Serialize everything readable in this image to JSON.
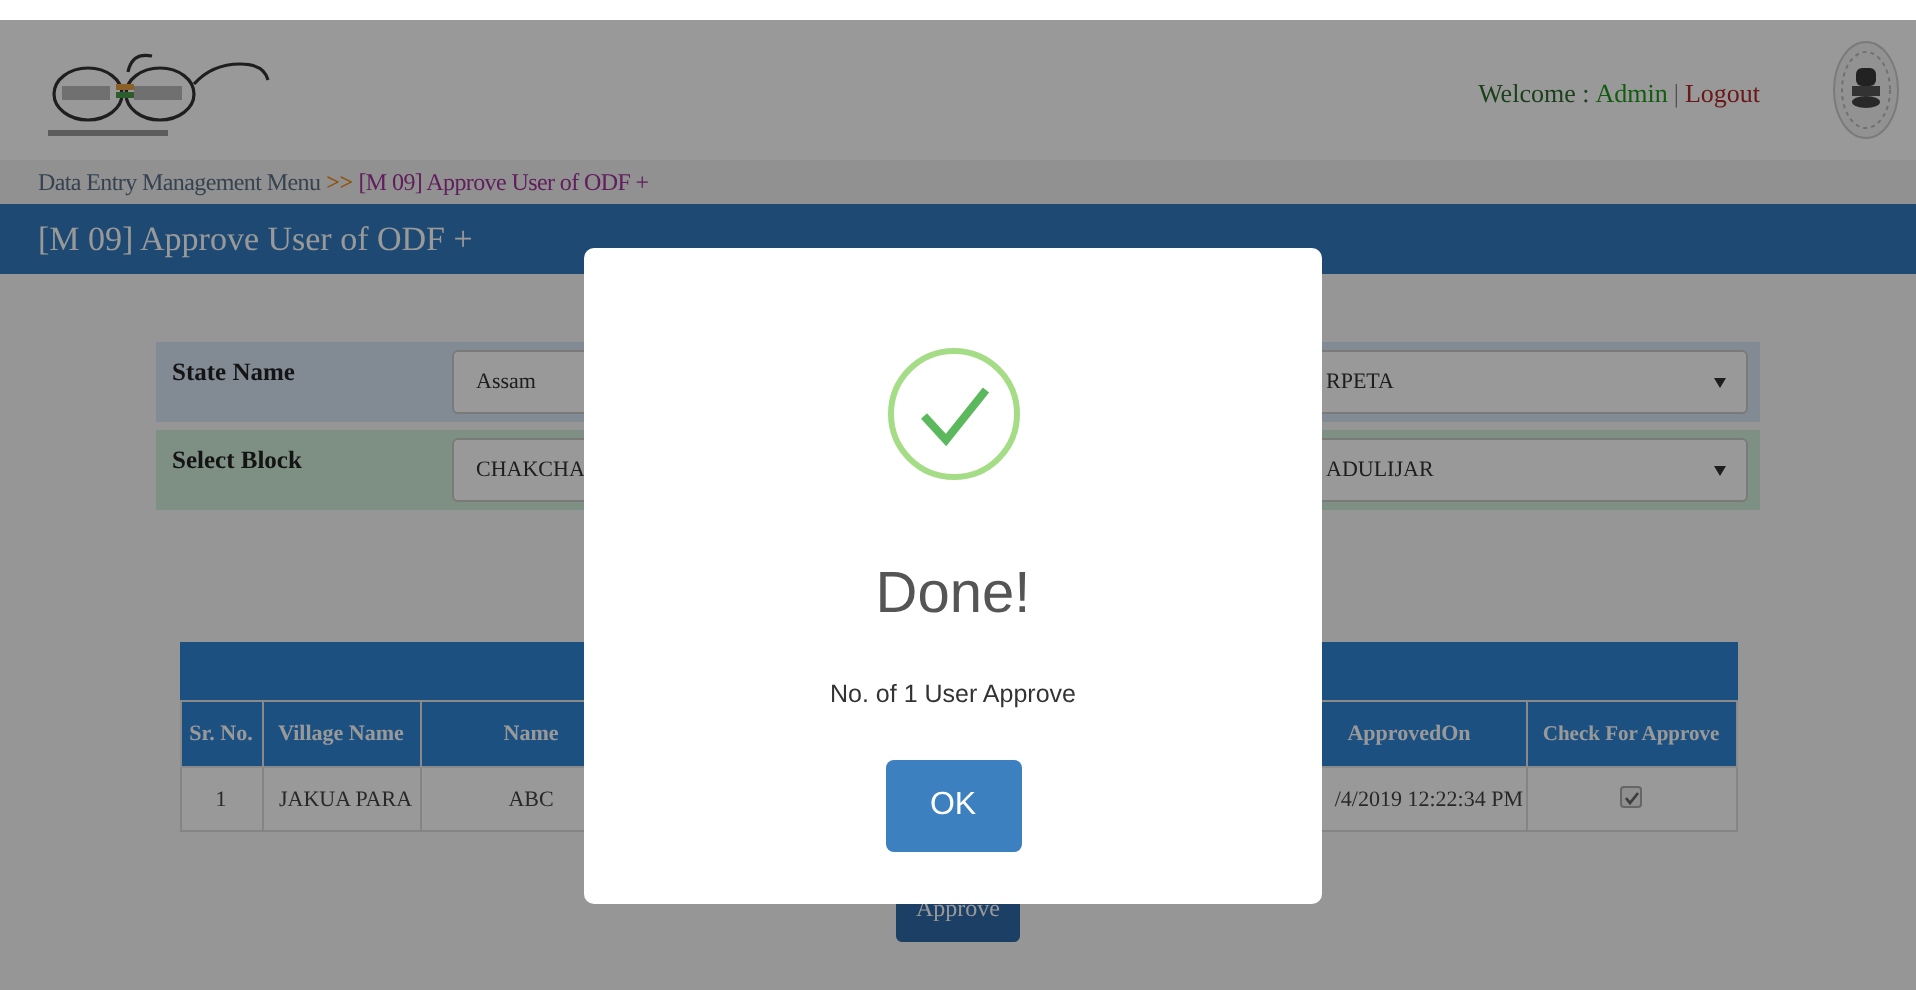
{
  "header": {
    "welcome_label": "Welcome :",
    "user": "Admin",
    "divider": "|",
    "logout": "Logout"
  },
  "breadcrumb": {
    "parent": "Data Entry Management Menu",
    "separator": ">>",
    "current": "[M 09] Approve User of ODF +"
  },
  "page_title": "[M 09] Approve User of ODF +",
  "filters": [
    {
      "label": "State Name",
      "left_value": "Assam",
      "right_value": "RPETA"
    },
    {
      "label": "Select Block",
      "left_value": "CHAKCHA",
      "right_value": "ADULIJAR"
    }
  ],
  "table": {
    "columns": [
      "Sr. No.",
      "Village Name",
      "Name",
      "ApprovedOn",
      "Check For Approve"
    ],
    "rows": [
      {
        "sr_no": "1",
        "village_name": "JAKUA PARA",
        "name": "ABC",
        "approved_on": "/4/2019 12:22:34 PM",
        "checked": true
      }
    ]
  },
  "approve_button": "Approve",
  "dialog": {
    "title": "Done!",
    "message": "No. of 1 User Approve",
    "button": "OK"
  }
}
